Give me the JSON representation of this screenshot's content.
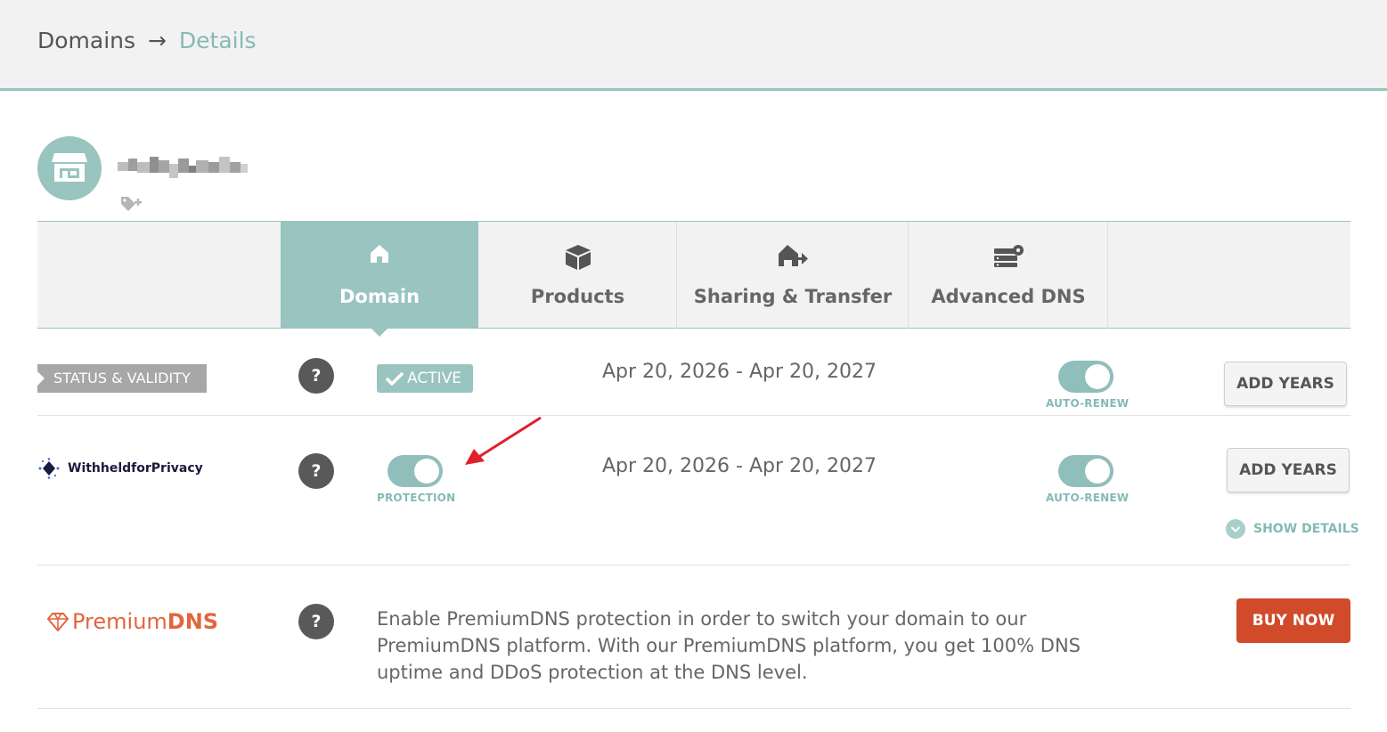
{
  "breadcrumb": {
    "parent": "Domains",
    "separator": "→",
    "current": "Details"
  },
  "domain": {
    "name": "",
    "avatar_icon": "storefront-icon",
    "tag_icon": "tag-add-icon"
  },
  "tabs": [
    {
      "label": "Domain",
      "icon": "home-icon",
      "active": true
    },
    {
      "label": "Products",
      "icon": "box-icon",
      "active": false
    },
    {
      "label": "Sharing & Transfer",
      "icon": "house-transfer-icon",
      "active": false
    },
    {
      "label": "Advanced DNS",
      "icon": "server-gear-icon",
      "active": false
    }
  ],
  "status_row": {
    "label": "STATUS & VALIDITY",
    "help": "?",
    "badge": "ACTIVE",
    "dates": "Apr 20, 2026 - Apr 20, 2027",
    "autorenew_caption": "AUTO-RENEW",
    "autorenew_on": true,
    "button": "ADD YEARS"
  },
  "privacy_row": {
    "logo_text": "WithheldforPrivacy",
    "help": "?",
    "protection_caption": "PROTECTION",
    "protection_on": true,
    "dates": "Apr 20, 2026 - Apr 20, 2027",
    "autorenew_caption": "AUTO-RENEW",
    "autorenew_on": true,
    "button": "ADD YEARS",
    "show_details": "SHOW DETAILS"
  },
  "premiumdns_row": {
    "logo_text_light": "Premium",
    "logo_text_bold": "DNS",
    "help": "?",
    "description": "Enable PremiumDNS protection in order to switch your domain to our PremiumDNS platform. With our PremiumDNS platform, you get 100% DNS uptime and DDoS protection at the DNS level.",
    "button": "BUY NOW"
  },
  "colors": {
    "accent": "#99c4c0",
    "accent_text": "#84bab6",
    "buy": "#d14b2a",
    "annotation_arrow": "#e0202a"
  }
}
